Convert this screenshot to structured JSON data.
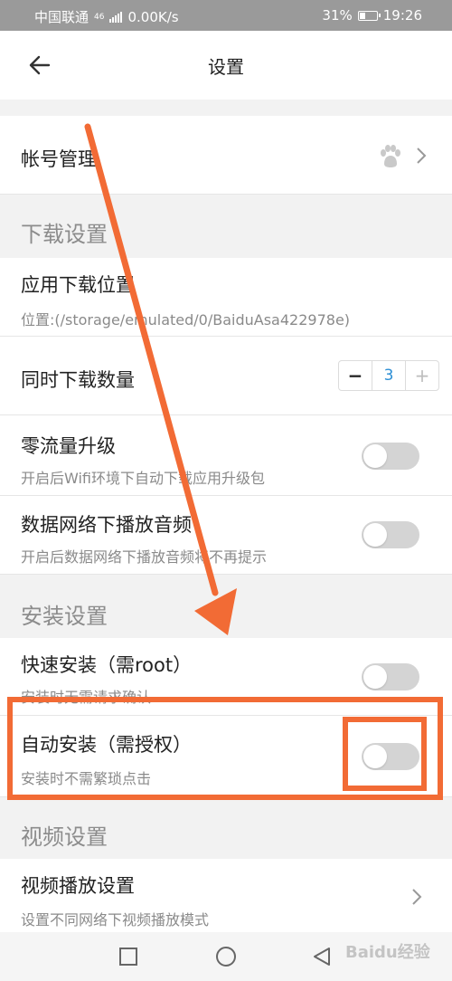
{
  "status_bar": {
    "carrier": "中国联通",
    "network": "46",
    "speed": "0.00K/s",
    "battery": "31%",
    "time": "19:26",
    "battery_level": 0.31
  },
  "app_bar": {
    "title": "设置",
    "back_icon": "arrow-left-icon"
  },
  "account": {
    "title": "帐号管理",
    "icon": "baidu-paw-icon"
  },
  "sections": {
    "download": "下载设置",
    "install": "安装设置",
    "video": "视频设置"
  },
  "download_location": {
    "title": "应用下载位置",
    "subtitle": "位置:(/storage/emulated/0/BaiduAsa422978e)"
  },
  "concurrent_downloads": {
    "title": "同时下载数量",
    "minus": "−",
    "value": "3",
    "plus": "+"
  },
  "zero_traffic_upgrade": {
    "title": "零流量升级",
    "subtitle": "开启后Wifi环境下自动下载应用升级包",
    "enabled": false
  },
  "mobile_audio": {
    "title": "数据网络下播放音频",
    "subtitle": "开启后数据网络下播放音频将不再提示",
    "enabled": false
  },
  "quick_install": {
    "title": "快速安装（需root）",
    "subtitle": "安装时无需请求确认",
    "enabled": false
  },
  "auto_install": {
    "title": "自动安装（需授权）",
    "subtitle": "安装时不需繁琐点击",
    "enabled": false
  },
  "video_playback": {
    "title": "视频播放设置",
    "subtitle": "设置不同网络下视频播放模式"
  },
  "nav": {
    "recent": "square-icon",
    "home": "circle-icon",
    "back": "triangle-back-icon"
  },
  "watermark": "Baidu经验",
  "colors": {
    "annotation": "#f26b35",
    "stepper_value": "#2d8fd5",
    "toggle_off": "#d4d4d4"
  }
}
